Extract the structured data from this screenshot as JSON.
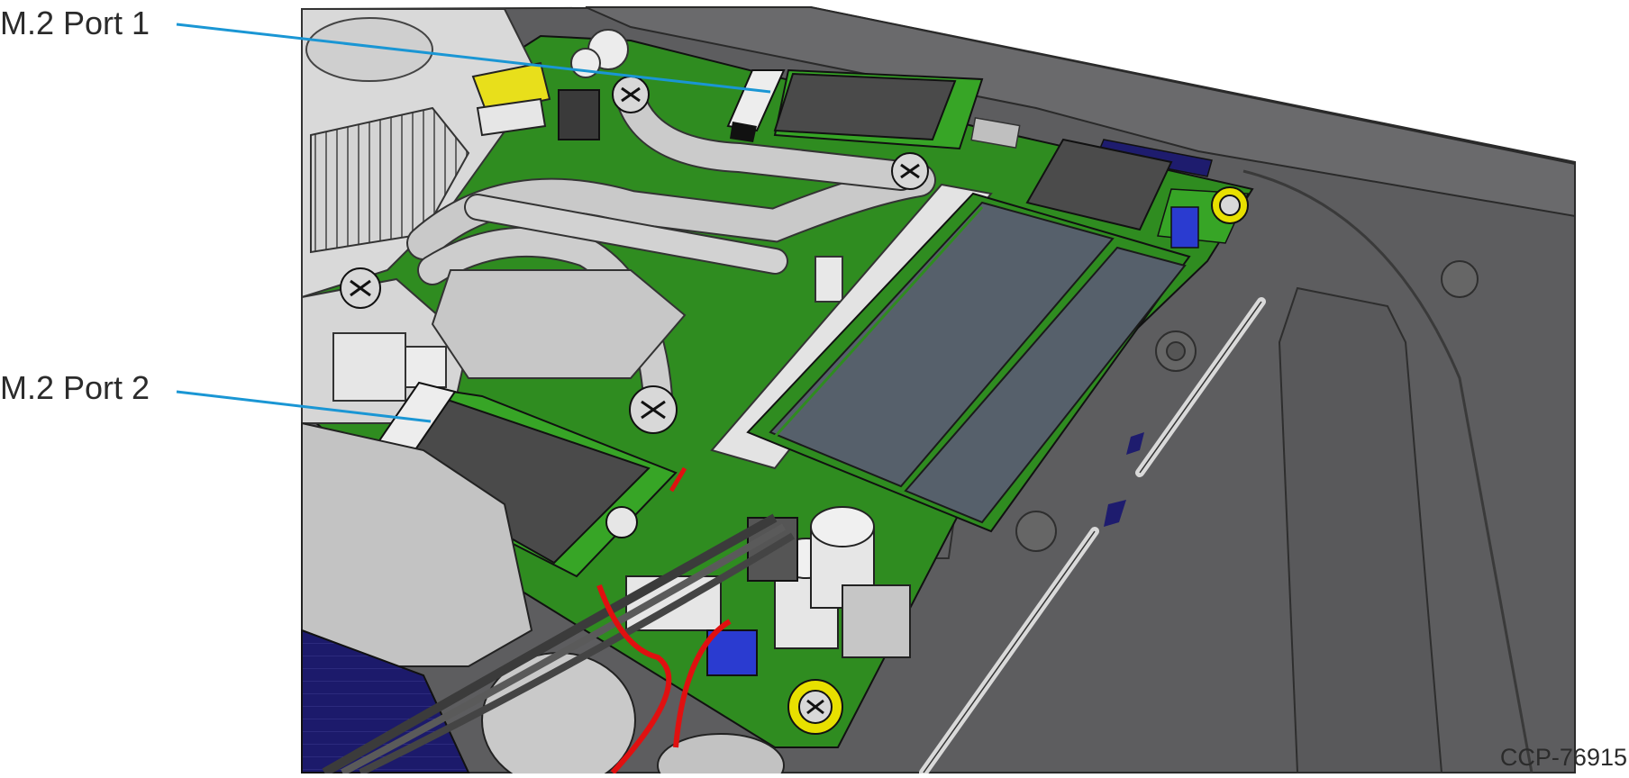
{
  "callouts": {
    "port1": "M.2 Port 1",
    "port2": "M.2 Port 2"
  },
  "figure_id": "CCP-76915",
  "colors": {
    "callout_line": "#1a96d4",
    "enclosure": "#5b5b5d",
    "board": "#2f8a1f",
    "heatsink": "#cfcfcf",
    "memory": "#565c63",
    "ssd": "#4e4e4e",
    "ground_ring": "#e8e000",
    "cable": "#e01010"
  }
}
